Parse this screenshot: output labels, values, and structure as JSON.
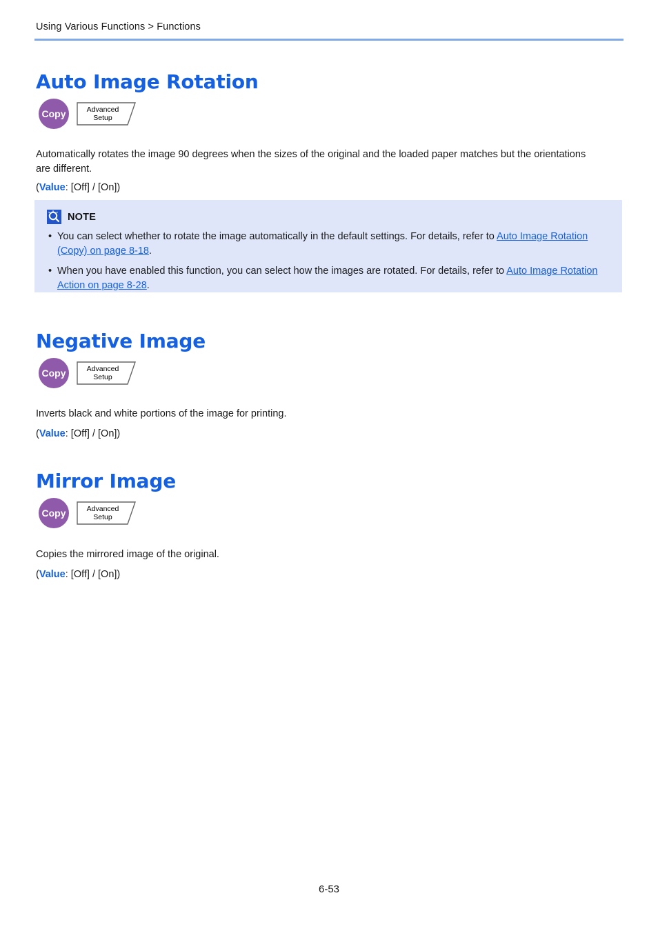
{
  "header": {
    "breadcrumb": "Using Various Functions > Functions",
    "rule_color": "#7fa9e8"
  },
  "colors": {
    "heading_blue": "#1560e0",
    "link_blue": "#1560e0",
    "badge_purple": "#8f5aa9",
    "note_background": "#dfe6fa",
    "note_icon_blue": "#2255cc"
  },
  "sections": [
    {
      "title": "Auto Image Rotation",
      "badge": {
        "mode_label": "Copy",
        "tab_line1": "Advanced",
        "tab_line2": "Setup"
      },
      "description": "Automatically rotates the image 90 degrees when the sizes of the original and the loaded paper matches but the orientations are different.",
      "value_open": "(",
      "value_keyword": "Value",
      "value_text": ": [Off] / [On])"
    },
    {
      "title": "Negative Image",
      "badge": {
        "mode_label": "Copy",
        "tab_line1": "Advanced",
        "tab_line2": "Setup"
      },
      "description": "Inverts black and white portions of the image for printing.",
      "value_open": "(",
      "value_keyword": "Value",
      "value_text": ": [Off] / [On])"
    },
    {
      "title": "Mirror Image",
      "badge": {
        "mode_label": "Copy",
        "tab_line1": "Advanced",
        "tab_line2": "Setup"
      },
      "description": "Copies the mirrored image of the original.",
      "value_open": "(",
      "value_keyword": "Value",
      "value_text": ": [Off] / [On])"
    }
  ],
  "note": {
    "icon_name": "note-magnifier-icon",
    "title": "NOTE",
    "bullet": "•",
    "items": [
      {
        "text_before": "You can select whether to rotate the image automatically in the default settings. For details, refer to ",
        "link": "Auto Image Rotation (Copy) on page 8-18",
        "text_after": "."
      },
      {
        "text_before": "When you have enabled this function, you can select how the images are rotated. For details, refer to ",
        "link": "Auto Image Rotation Action on page 8-28",
        "text_after": "."
      }
    ]
  },
  "footer": {
    "page_number": "6-53"
  }
}
